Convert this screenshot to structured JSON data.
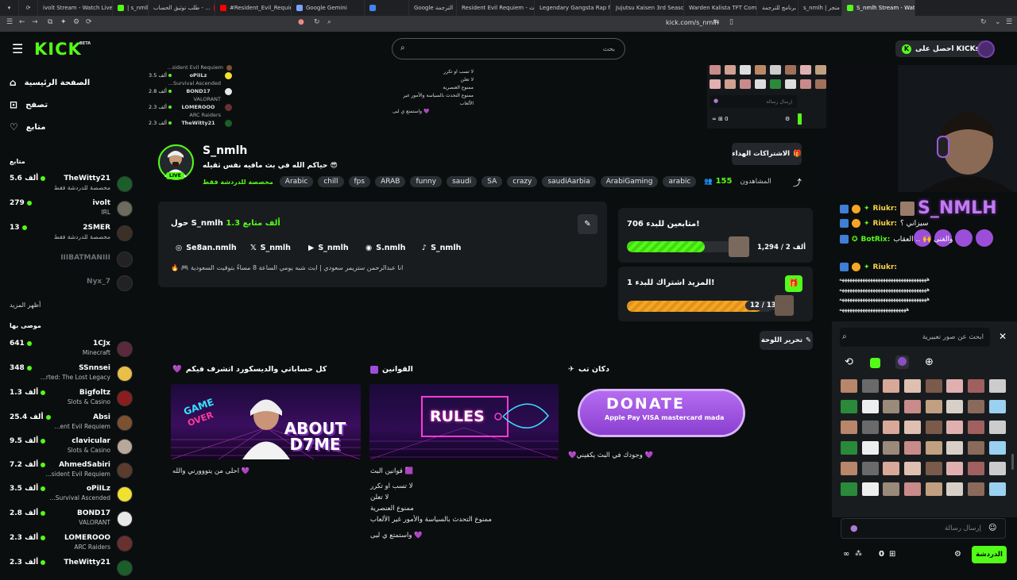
{
  "browser": {
    "tabs": [
      {
        "label": "ivolt Stream - Watch Live ...",
        "color": "#53fc18"
      },
      {
        "label": "| s_nmlh",
        "color": "#53fc18"
      },
      {
        "label": "طلب توثيق الحساب - ...",
        "color": "#ff0000"
      },
      {
        "label": "#Resident_Evil_Requiem - ...",
        "color": "#ff0000"
      },
      {
        "label": "Google Gemini",
        "color": "#7aa3ff"
      },
      {
        "label": "Google الترجمة",
        "color": "#4285f4"
      },
      {
        "label": "Resident Evil Requiem - بحث ...",
        "color": "#4285f4"
      },
      {
        "label": "Legendary Gangsta Rap from ...",
        "color": "#ff0000"
      },
      {
        "label": "Jujutsu Kaisen 3rd Season ...",
        "color": "#ff0000"
      },
      {
        "label": "Warden Kalista TFT Comp Gui...",
        "color": "#3f7fd6"
      },
      {
        "label": "أفضل برنامج للترجمة | ...",
        "color": "#e8a33c"
      },
      {
        "label": "s_nmlh | متجر",
        "color": "#53fc18"
      },
      {
        "label": "S_nmlh Stream - Watch Live ...",
        "color": "#53fc18",
        "active": true
      }
    ],
    "url": "kick.com/s_nmlh"
  },
  "header": {
    "logo": "KICK",
    "beta": "BETA",
    "search_placeholder": "بحث",
    "get_kicks": "احصل على KICKs"
  },
  "sidebar": {
    "nav": [
      {
        "label": "الصفحة الرئيسية",
        "icon": "home-icon"
      },
      {
        "label": "تصفح",
        "icon": "browse-icon"
      },
      {
        "label": "متابع",
        "icon": "heart-icon"
      }
    ],
    "following_title": "متابع",
    "following": [
      {
        "name": "TheWitty21",
        "category": "مخصصة للدردشة فقط",
        "viewers": "5.6 ألف",
        "live": true
      },
      {
        "name": "ivolt",
        "category": "IRL",
        "viewers": "279",
        "live": true
      },
      {
        "name": "2SMER",
        "category": "مخصصة للدردشة فقط",
        "viewers": "13",
        "live": true
      },
      {
        "name": "IIIBATMANIII",
        "category": "",
        "viewers": "",
        "live": false
      },
      {
        "name": "Nyx_7",
        "category": "",
        "viewers": "",
        "live": false
      }
    ],
    "show_more": "أظهر المزيد",
    "recommended_title": "موصى بها",
    "recommended": [
      {
        "name": "1CJx",
        "category": "Minecraft",
        "viewers": "641"
      },
      {
        "name": "SSnnsei",
        "category": "...rted: The Lost Legacy",
        "viewers": "348"
      },
      {
        "name": "Bigfoltz",
        "category": "Slots & Casino",
        "viewers": "1.3 ألف"
      },
      {
        "name": "Absi",
        "category": "...ent Evil Requiem",
        "viewers": "25.4 ألف"
      },
      {
        "name": "clavicular",
        "category": "Slots & Casino",
        "viewers": "9.5 ألف"
      },
      {
        "name": "AhmedSabiri",
        "category": "...sident Evil Requiem",
        "viewers": "7.2 ألف"
      },
      {
        "name": "oPiILz",
        "category": "...Survival Ascended",
        "viewers": "3.5 ألف"
      },
      {
        "name": "BOND17",
        "category": "VALORANT",
        "viewers": "2.8 ألف"
      },
      {
        "name": "LOMEROOO",
        "category": "ARC Raiders",
        "viewers": "2.3 ألف"
      },
      {
        "name": "TheWitty21",
        "category": "",
        "viewers": "2.3 ألف"
      }
    ]
  },
  "strip": {
    "mini_rows": [
      {
        "category": "...sident Evil Requiem",
        "name": "",
        "viewers": ""
      },
      {
        "category": "",
        "name": "oPiILz",
        "viewers": "3.5 ألف"
      },
      {
        "category": "...Survival Ascended",
        "name": "",
        "viewers": ""
      },
      {
        "category": "",
        "name": "BOND17",
        "viewers": "2.8 ألف"
      },
      {
        "category": "VALORANT",
        "name": "",
        "viewers": ""
      },
      {
        "category": "",
        "name": "LOMEROOO",
        "viewers": "2.3 ألف"
      },
      {
        "category": "ARC Raiders",
        "name": "",
        "viewers": ""
      },
      {
        "category": "",
        "name": "TheWitty21",
        "viewers": "2.3 ألف"
      }
    ],
    "rules": [
      "لا تسب او تكرر",
      "لا تعلن",
      "ممنوع العنصرية",
      "ممنوع التحدث بالسياسة والأمور غير الألعاب",
      "واستمتع ي لبى 💜"
    ],
    "mini_chat_placeholder": "إرسال رسالة",
    "mini_count": "0"
  },
  "profile": {
    "name": "S_nmlh",
    "live": "LIVE",
    "title": "حياكم الله في بث مافيه نفس ثقيله 😎",
    "sub_only": "مخصصة للدردشة فقط",
    "tags": [
      "Arabic",
      "chill",
      "fps",
      "ARAB",
      "funny",
      "saudi",
      "SA",
      "crazy",
      "saudiAarbia",
      "ArabiGaming",
      "arabic"
    ],
    "subscribe": "الاشتراكات الهداء",
    "viewers_label": "المشاهدون",
    "viewers": "155"
  },
  "about": {
    "title_prefix": "حول S_nmlh",
    "followers": "1.3 ألف متابع",
    "socials": [
      {
        "label": "Se8an.nmlh",
        "icon": "instagram-icon"
      },
      {
        "label": "S_nmlh",
        "icon": "x-icon"
      },
      {
        "label": "S_nmlh",
        "icon": "youtube-icon"
      },
      {
        "label": "S.nmlh",
        "icon": "discord-icon"
      },
      {
        "label": "S_nmlh",
        "icon": "tiktok-icon"
      }
    ],
    "bio": "🔥 🎮 انا عبدالرحمن ستريمر سعودي | ابث شبه يومي الساعة 8 مساءً بتوقيت السعودية"
  },
  "goals": {
    "followers_title": "706 متابعين للبدء!",
    "followers_count": "1,294 / 2 ألف",
    "followers_progress": 0.647,
    "subs_title": "المزيد اشتراك للبدء 1!",
    "subs_count": "12 / 13",
    "subs_progress": 0.923,
    "edit_panel": "تحرير اللوحة"
  },
  "panels": [
    {
      "title": "كل حساباتي والديسكورد اتشرف فيكم",
      "icon": "heart-icon",
      "image": "ABOUT D7ME",
      "image_sub": "GAME OVER",
      "text": [
        "احلى من يتووورني والله 💜"
      ]
    },
    {
      "title": "القوانين",
      "icon": "square-icon",
      "image": "RULES",
      "text": [
        "قوانين البث 🟪",
        "لا تسب او تكرر",
        "لا تعلن",
        "ممنوع العنصرية",
        "ممنوع التحدث بالسياسة والأمور غير الألعاب",
        "واستمتع ي لبى 💜"
      ]
    },
    {
      "title": "دكان تب",
      "icon": "plane-icon",
      "image": "DONATE",
      "image_sub": "Apple Pay  VISA  mastercard  mada",
      "text": [
        "💜وجودك في البث يكفيني 💜"
      ]
    }
  ],
  "video": {
    "overlay_name": "S_NMLH"
  },
  "chat": {
    "messages": [
      {
        "user": "Riukr:",
        "text": "",
        "user_color": "#f5d14a"
      },
      {
        "user": "Riukr:",
        "text": "سيزاني ؟",
        "user_color": "#f5d14a"
      },
      {
        "user": "BotRix:",
        "text": "والغنى 🙌 .. العقاب",
        "user_color": "#53fc18"
      },
      {
        "user": "Riukr:",
        "text": "",
        "user_color": "#f5d14a"
      }
    ],
    "spam_lines": [
      "ههههههههههههههههههههههههههههههههههه",
      "ههههههههههههههههههههههههههههههههههه",
      "ههههههههههههههههههههههههههههههههههه",
      "ههههههههههههههههههههههههههه"
    ],
    "emote_search_placeholder": "ابحث عن صور تعبيرية",
    "input_placeholder": "إرسال رسالة",
    "count": "0",
    "send": "الدردشة"
  },
  "colors": {
    "brand": "#53fc18",
    "bg": "#0b0e0f",
    "card": "#191c1f"
  }
}
